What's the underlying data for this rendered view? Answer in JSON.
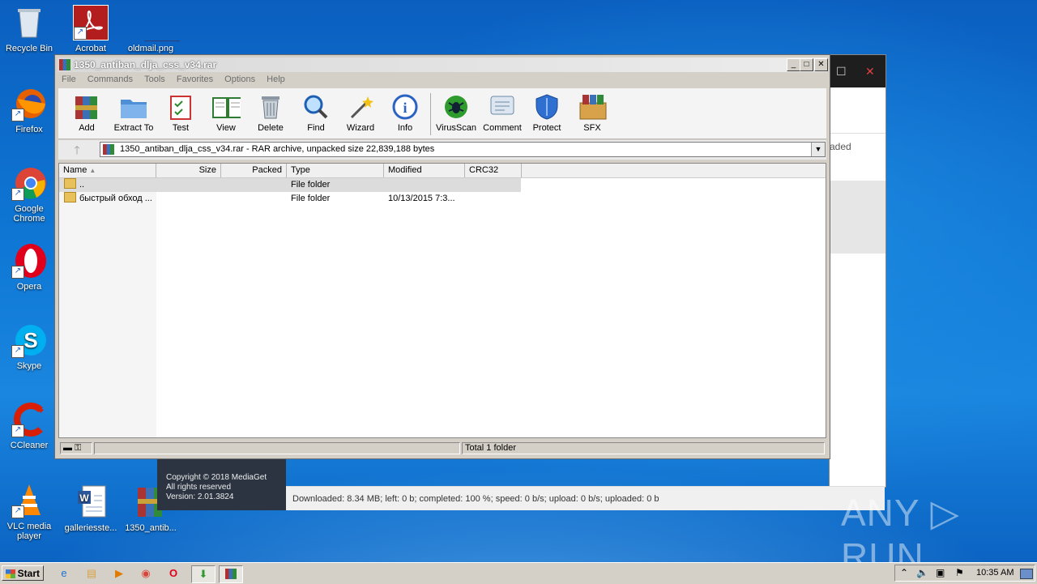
{
  "desktop": {
    "icons": [
      {
        "label": "Recycle Bin",
        "icon": "recycle-bin-icon"
      },
      {
        "label": "Acrobat",
        "icon": "acrobat-icon"
      },
      {
        "label": "oldmail.png",
        "icon": "image-file-icon"
      },
      {
        "label": "Firefox",
        "icon": "firefox-icon"
      },
      {
        "label": "Google Chrome",
        "icon": "chrome-icon"
      },
      {
        "label": "Opera",
        "icon": "opera-icon"
      },
      {
        "label": "Skype",
        "icon": "skype-icon"
      },
      {
        "label": "CCleaner",
        "icon": "ccleaner-icon"
      },
      {
        "label": "VLC media player",
        "icon": "vlc-icon"
      },
      {
        "label": "galleriesste...",
        "icon": "word-doc-icon"
      },
      {
        "label": "1350_antib...",
        "icon": "winrar-archive-icon"
      }
    ]
  },
  "mediaget": {
    "partial_text": "aded",
    "close_glyph": "✕",
    "max_glyph": "☐",
    "status": "Downloaded: 8.34 MB; left: 0 b; completed: 100 %; speed: 0 b/s; upload: 0 b/s; uploaded: 0 b",
    "copyright": "Copyright © 2018 MediaGet",
    "rights": "All rights reserved",
    "version": "Version: 2.01.3824"
  },
  "winrar": {
    "title": "1350_antiban_dlja_css_v34.rar",
    "menu": [
      "File",
      "Commands",
      "Tools",
      "Favorites",
      "Options",
      "Help"
    ],
    "toolbar": [
      {
        "label": "Add",
        "icon": "add-archive-icon"
      },
      {
        "label": "Extract To",
        "icon": "extract-folder-icon"
      },
      {
        "label": "Test",
        "icon": "test-clipboard-icon"
      },
      {
        "label": "View",
        "icon": "view-book-icon"
      },
      {
        "label": "Delete",
        "icon": "trash-icon"
      },
      {
        "label": "Find",
        "icon": "magnifier-icon"
      },
      {
        "label": "Wizard",
        "icon": "magic-wand-icon"
      },
      {
        "label": "Info",
        "icon": "info-icon"
      },
      {
        "label": "VirusScan",
        "icon": "virus-scan-icon"
      },
      {
        "label": "Comment",
        "icon": "comment-icon"
      },
      {
        "label": "Protect",
        "icon": "shield-icon"
      },
      {
        "label": "SFX",
        "icon": "sfx-box-icon"
      }
    ],
    "address": "1350_antiban_dlja_css_v34.rar - RAR archive, unpacked size 22,839,188 bytes",
    "columns": [
      "Name",
      "Size",
      "Packed",
      "Type",
      "Modified",
      "CRC32"
    ],
    "rows": [
      {
        "name": "..",
        "size": "",
        "packed": "",
        "type": "File folder",
        "modified": "",
        "crc": ""
      },
      {
        "name": "быстрый обход ...",
        "size": "",
        "packed": "",
        "type": "File folder",
        "modified": "10/13/2015 7:3...",
        "crc": ""
      }
    ],
    "status_total": "Total 1 folder"
  },
  "taskbar": {
    "start": "Start",
    "clock": "10:35 AM"
  },
  "watermark": "ANY ▷ RUN"
}
